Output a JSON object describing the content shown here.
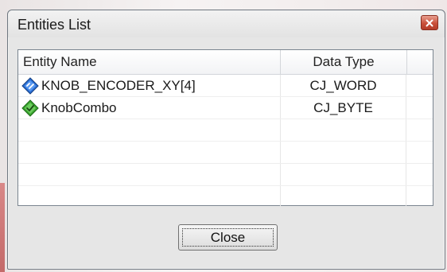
{
  "window": {
    "title": "Entities List"
  },
  "table": {
    "columns": [
      "Entity Name",
      "Data Type"
    ],
    "rows": [
      {
        "name": "KNOB_ENCODER_XY[4]",
        "type": "CJ_WORD",
        "icon": "blue-diamond-icon",
        "icon_color": "#2a6fd6"
      },
      {
        "name": "KnobCombo",
        "type": "CJ_BYTE",
        "icon": "green-diamond-icon",
        "icon_color": "#3aa52f"
      }
    ]
  },
  "buttons": {
    "close_label": "Close"
  },
  "colors": {
    "close_button_red": "#c9503a"
  }
}
